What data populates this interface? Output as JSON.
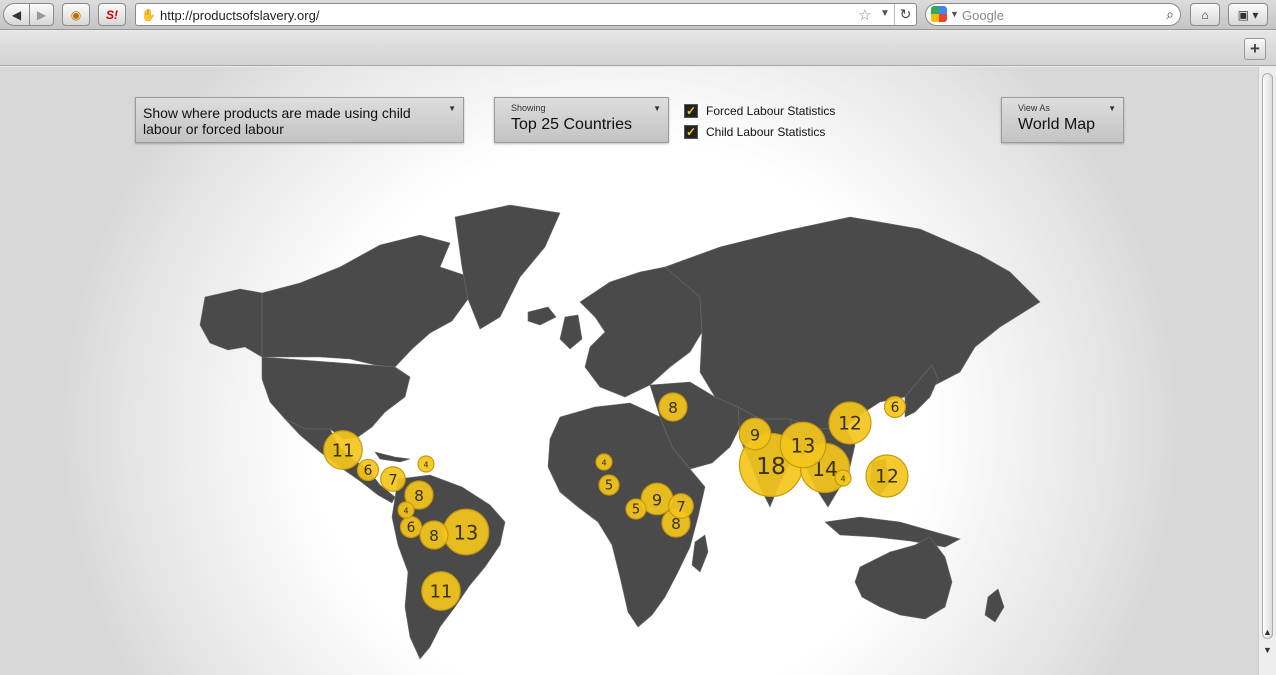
{
  "browser": {
    "url": "http://productsofslavery.org/",
    "search_placeholder": "Google"
  },
  "controls": {
    "filter_label": "Show where products are made using child labour or forced labour",
    "showing_small": "Showing",
    "showing_value": "Top 25 Countries",
    "check_forced_label": "Forced Labour Statistics",
    "check_forced_checked": true,
    "check_child_label": "Child Labour Statistics",
    "check_child_checked": true,
    "view_small": "View As",
    "view_value": "World Map"
  },
  "colors": {
    "land": "#4a4a4a",
    "bubble": "#f3c51c",
    "bubble_border": "#c99a08"
  },
  "bubbles": [
    {
      "region": "Mexico",
      "value": "11"
    },
    {
      "region": "Guatemala",
      "value": "6"
    },
    {
      "region": "Nicaragua",
      "value": "7"
    },
    {
      "region": "Dominican Republic",
      "value": "4"
    },
    {
      "region": "Colombia",
      "value": "8"
    },
    {
      "region": "Ecuador",
      "value": "4"
    },
    {
      "region": "Peru",
      "value": "6"
    },
    {
      "region": "Bolivia",
      "value": "8"
    },
    {
      "region": "Brazil",
      "value": "13"
    },
    {
      "region": "Argentina",
      "value": "11"
    },
    {
      "region": "Turkey",
      "value": "8"
    },
    {
      "region": "Burkina Faso",
      "value": "4"
    },
    {
      "region": "Nigeria",
      "value": "5"
    },
    {
      "region": "DR Congo",
      "value": "5"
    },
    {
      "region": "Uganda",
      "value": "9"
    },
    {
      "region": "Kenya",
      "value": "7"
    },
    {
      "region": "Tanzania",
      "value": "8"
    },
    {
      "region": "Pakistan",
      "value": "9"
    },
    {
      "region": "India",
      "value": "18"
    },
    {
      "region": "Bangladesh",
      "value": "13"
    },
    {
      "region": "Thailand",
      "value": "14"
    },
    {
      "region": "Cambodia",
      "value": "4"
    },
    {
      "region": "China",
      "value": "12"
    },
    {
      "region": "South Korea",
      "value": "6"
    },
    {
      "region": "Philippines",
      "value": "12"
    }
  ]
}
